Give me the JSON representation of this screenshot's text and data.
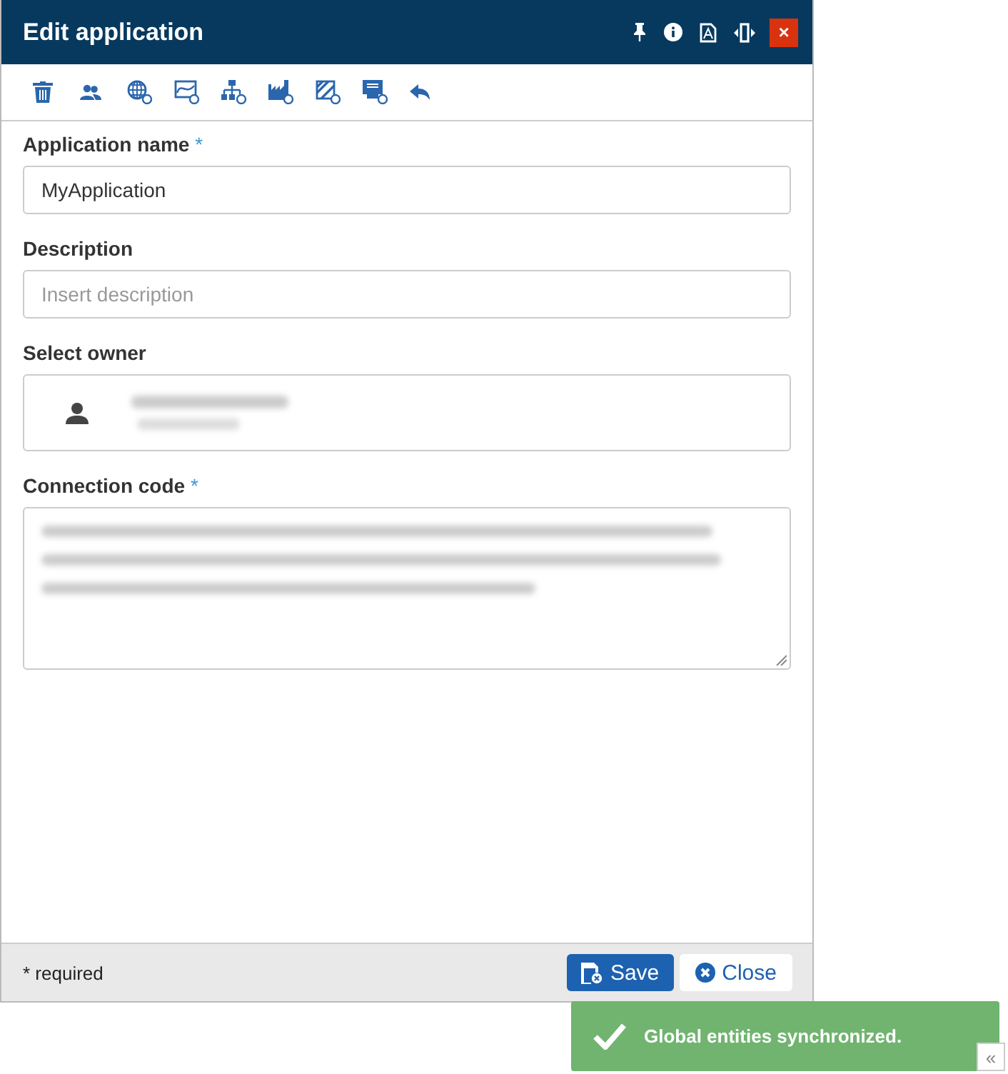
{
  "window": {
    "title": "Edit application",
    "close_glyph": "×"
  },
  "form": {
    "fields": [
      {
        "kind": "text",
        "label": "Application name",
        "required_mark": "*",
        "value": "MyApplication"
      },
      {
        "kind": "text",
        "label": "Description",
        "placeholder": "Insert description"
      },
      {
        "kind": "owner",
        "label": "Select owner"
      },
      {
        "kind": "textarea",
        "label": "Connection code",
        "required_mark": "*"
      }
    ]
  },
  "footer": {
    "note": "* required",
    "buttons": [
      {
        "kind": "primary",
        "label": "Save"
      },
      {
        "kind": "secondary",
        "label": "Close"
      }
    ]
  },
  "toast": {
    "message": "Global entities synchronized."
  },
  "collapse_button": {
    "glyph": "«"
  }
}
